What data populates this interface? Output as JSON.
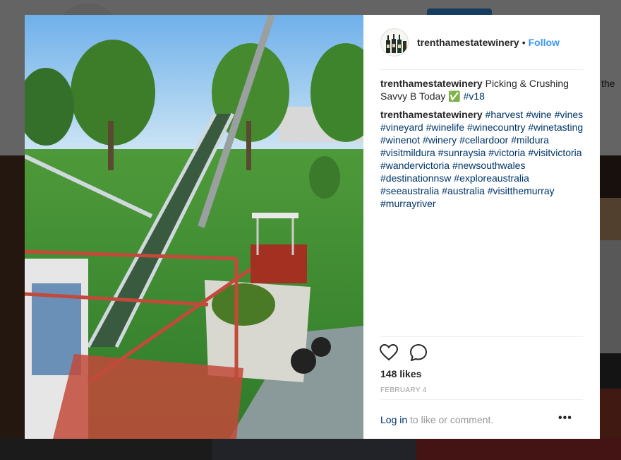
{
  "background": {
    "partial_text": "the"
  },
  "post": {
    "username": "trenthamestatewinery",
    "separator": "•",
    "follow_label": "Follow",
    "caption": {
      "user": "trenthamestatewinery",
      "text": "Picking & Crushing Savvy B Today ✅",
      "hashtag": "#v18"
    },
    "hashtag_comment": {
      "user": "trenthamestatewinery",
      "tags": [
        "#harvest",
        "#wine",
        "#vines",
        "#vineyard",
        "#winelife",
        "#winecountry",
        "#winetasting",
        "#winenot",
        "#winery",
        "#cellardoor",
        "#mildura",
        "#visitmildura",
        "#sunraysia",
        "#victoria",
        "#visitvictoria",
        "#wandervictoria",
        "#newsouthwales",
        "#destinationnsw",
        "#exploreaustralia",
        "#seeaustralia",
        "#australia",
        "#visitthemurray",
        "#murrayriver"
      ]
    },
    "likes": "148 likes",
    "date": "FEBRUARY 4",
    "login_link": "Log in",
    "login_suffix": " to like or comment.",
    "more_label": "•••"
  },
  "icons": {
    "like": "heart-icon",
    "comment": "comment-icon",
    "more": "more-options-icon"
  },
  "colors": {
    "accent": "#3897f0",
    "hashtag": "#003569",
    "text": "#262626",
    "muted": "#999999"
  }
}
